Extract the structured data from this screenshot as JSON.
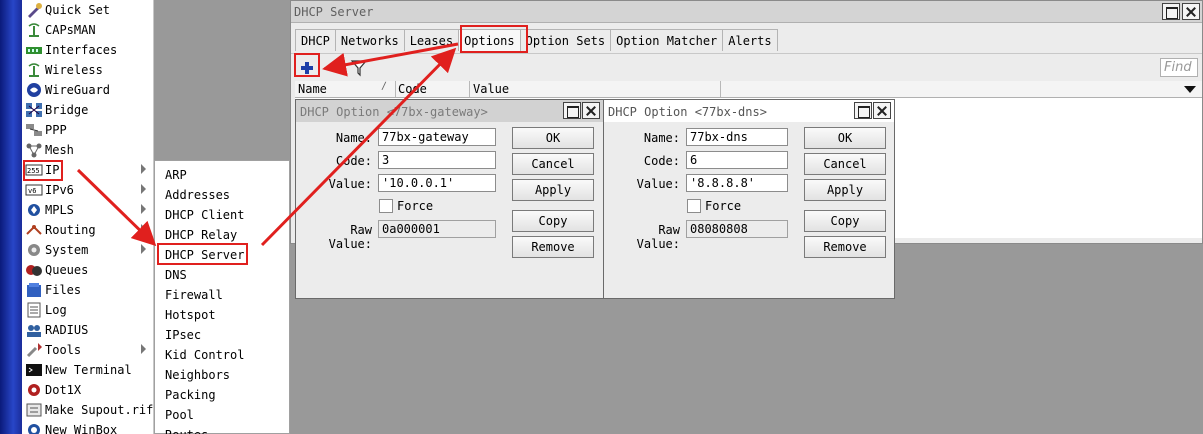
{
  "menu": {
    "items": [
      {
        "label": "Quick Set",
        "icon": "quick-set-icon"
      },
      {
        "label": "CAPsMAN",
        "icon": "capsman-icon"
      },
      {
        "label": "Interfaces",
        "icon": "interfaces-icon"
      },
      {
        "label": "Wireless",
        "icon": "wireless-icon"
      },
      {
        "label": "WireGuard",
        "icon": "wireguard-icon"
      },
      {
        "label": "Bridge",
        "icon": "bridge-icon"
      },
      {
        "label": "PPP",
        "icon": "ppp-icon"
      },
      {
        "label": "Mesh",
        "icon": "mesh-icon"
      },
      {
        "label": "IP",
        "icon": "ip-icon"
      },
      {
        "label": "IPv6",
        "icon": "ipv6-icon"
      },
      {
        "label": "MPLS",
        "icon": "mpls-icon"
      },
      {
        "label": "Routing",
        "icon": "routing-icon"
      },
      {
        "label": "System",
        "icon": "system-icon"
      },
      {
        "label": "Queues",
        "icon": "queues-icon"
      },
      {
        "label": "Files",
        "icon": "files-icon"
      },
      {
        "label": "Log",
        "icon": "log-icon"
      },
      {
        "label": "RADIUS",
        "icon": "radius-icon"
      },
      {
        "label": "Tools",
        "icon": "tools-icon"
      },
      {
        "label": "New Terminal",
        "icon": "terminal-icon"
      },
      {
        "label": "Dot1X",
        "icon": "dot1x-icon"
      },
      {
        "label": "Make Supout.rif",
        "icon": "supout-icon"
      },
      {
        "label": "New WinBox",
        "icon": "winbox-icon"
      }
    ]
  },
  "ip_submenu": {
    "items": [
      "ARP",
      "Addresses",
      "DHCP Client",
      "DHCP Relay",
      "DHCP Server",
      "DNS",
      "Firewall",
      "Hotspot",
      "IPsec",
      "Kid Control",
      "Neighbors",
      "Packing",
      "Pool",
      "Routes"
    ]
  },
  "dhcp_server": {
    "title": "DHCP Server",
    "tabs": [
      "DHCP",
      "Networks",
      "Leases",
      "Options",
      "Option Sets",
      "Option Matcher",
      "Alerts"
    ],
    "active_tab": "Options",
    "find_placeholder": "Find",
    "columns": [
      "Name",
      "Code",
      "Value"
    ]
  },
  "dialog_gateway": {
    "title": "DHCP Option <77bx-gateway>",
    "name_label": "Name:",
    "name": "77bx-gateway",
    "code_label": "Code:",
    "code": "3",
    "value_label": "Value:",
    "value": "'10.0.0.1'",
    "force_label": "Force",
    "raw_label": "Raw Value:",
    "raw": "0a000001",
    "buttons": {
      "ok": "OK",
      "cancel": "Cancel",
      "apply": "Apply",
      "copy": "Copy",
      "remove": "Remove"
    }
  },
  "dialog_dns": {
    "title": "DHCP Option <77bx-dns>",
    "name_label": "Name:",
    "name": "77bx-dns",
    "code_label": "Code:",
    "code": "6",
    "value_label": "Value:",
    "value": "'8.8.8.8'",
    "force_label": "Force",
    "raw_label": "Raw Value:",
    "raw": "08080808",
    "buttons": {
      "ok": "OK",
      "cancel": "Cancel",
      "apply": "Apply",
      "copy": "Copy",
      "remove": "Remove"
    }
  },
  "colors": {
    "highlight": "#e0201e",
    "accent": "#1d3fa8"
  }
}
